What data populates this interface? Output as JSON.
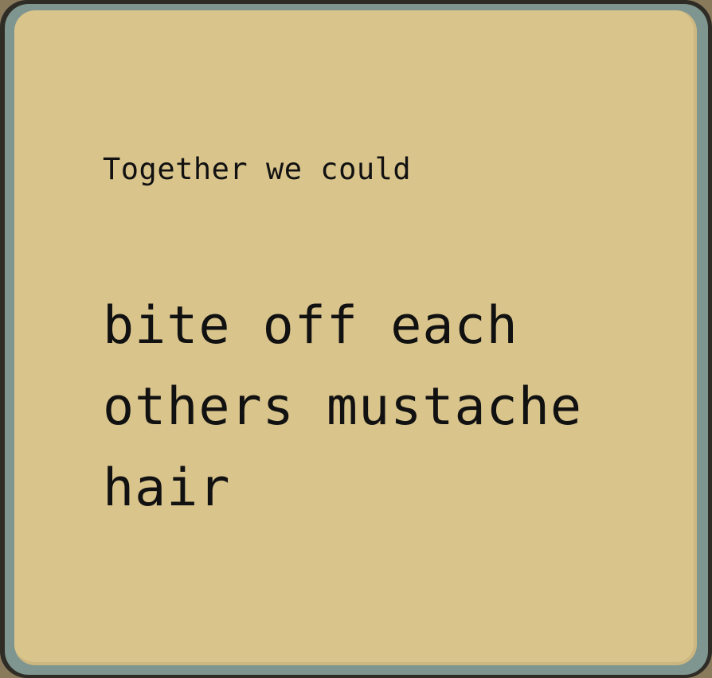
{
  "card": {
    "prompt": "Together we could",
    "answer": "bite off each\nothers mustache\nhair",
    "colors": {
      "face": "#d9c48c",
      "rim": "#7f9690",
      "outline": "#2f2c26",
      "text": "#111111"
    }
  }
}
